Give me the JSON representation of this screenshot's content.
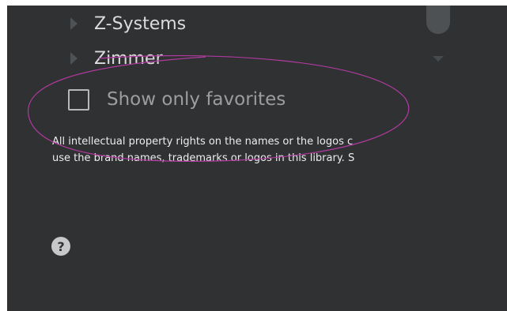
{
  "tree": {
    "items": [
      {
        "label": "Z-Systems"
      },
      {
        "label": "Zimmer"
      }
    ]
  },
  "favorites_toggle": {
    "label": "Show only favorites",
    "checked": false
  },
  "disclaimer": {
    "line1": "All intellectual property rights on the names or the logos c",
    "line2": "use the brand names, trademarks or logos in this library. S"
  },
  "help": {
    "icon": "question-mark-icon",
    "glyph": "?"
  },
  "colors": {
    "panel_background": "#2f3133",
    "annotation_stroke": "#b03a9e"
  }
}
